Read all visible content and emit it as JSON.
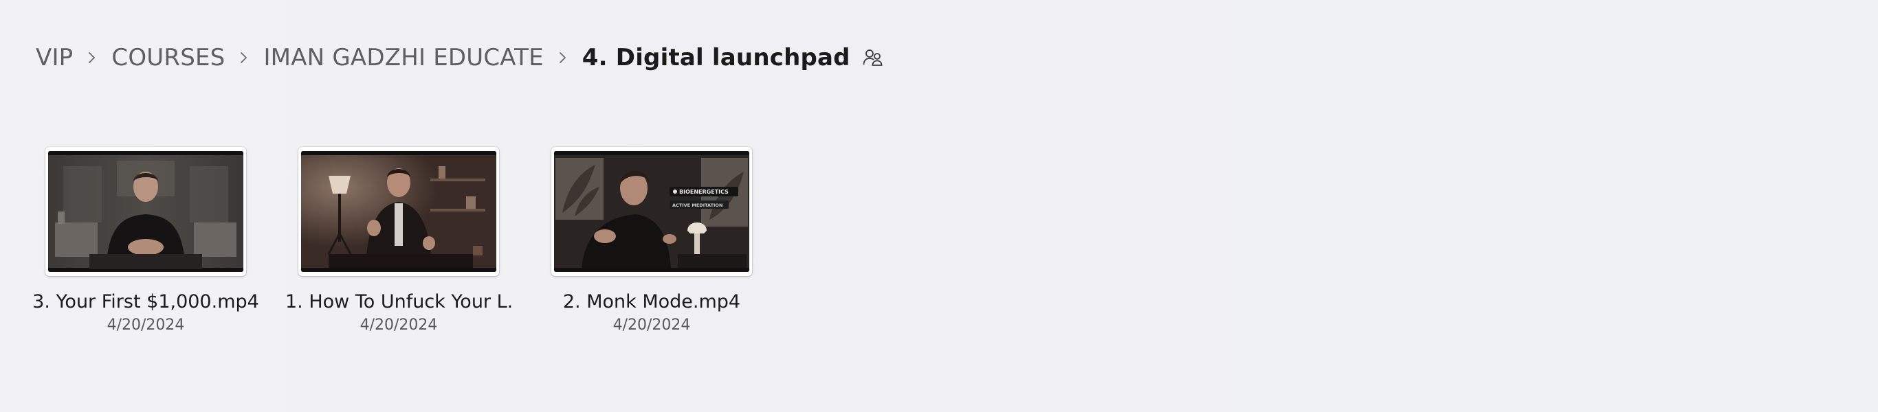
{
  "breadcrumb": {
    "items": [
      {
        "label": "VIP"
      },
      {
        "label": "COURSES"
      },
      {
        "label": "IMAN GADZHI EDUCATE"
      }
    ],
    "current": "4. Digital launchpad",
    "shared_icon": "people-shared-icon",
    "separator_icon": "chevron-right-icon"
  },
  "files": [
    {
      "name": "3. Your First $1,000.mp4",
      "date": "4/20/2024"
    },
    {
      "name": "1. How To Unfuck Your L...",
      "date": "4/20/2024"
    },
    {
      "name": "2. Monk Mode.mp4",
      "date": "4/20/2024"
    }
  ],
  "thumbnail_overlay": {
    "line1": "BIOENERGETICS",
    "line2": "ACTIVE MEDITATION"
  }
}
